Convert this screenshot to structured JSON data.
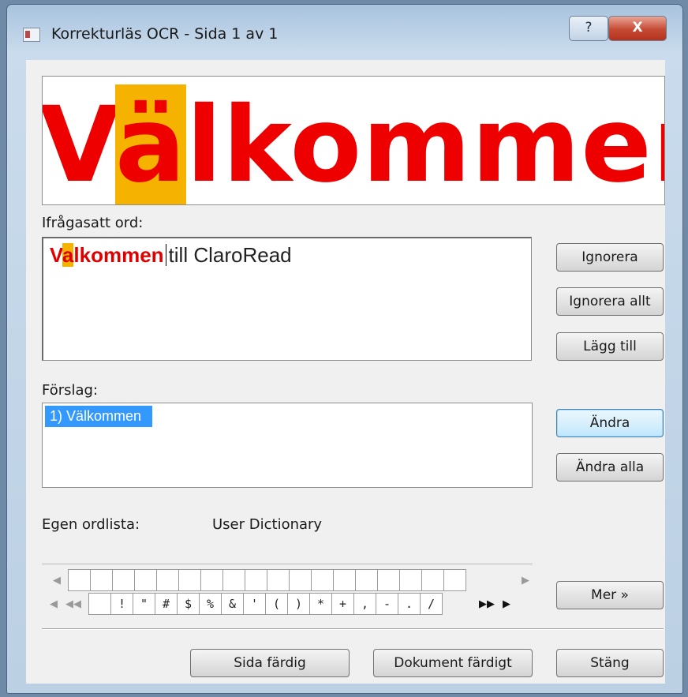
{
  "window": {
    "title": "Korrekturläs OCR - Sida 1 av 1",
    "help_label": "?",
    "close_label": "X"
  },
  "preview": {
    "word_pre": "V",
    "word_hl": "ä",
    "word_post": "lkommen"
  },
  "question": {
    "label": "Ifrågasatt ord:",
    "word_pre": "V",
    "word_hl": "a",
    "word_post": "lkommen",
    "rest": "till ClaroRead"
  },
  "suggestions": {
    "label": "Förslag:",
    "items": [
      "1) Välkommen"
    ]
  },
  "dictionary": {
    "label": "Egen ordlista:",
    "value": "User Dictionary"
  },
  "buttons": {
    "ignore": "Ignorera",
    "ignore_all": "Ignorera allt",
    "add": "Lägg till",
    "change": "Ändra",
    "change_all": "Ändra alla",
    "more": "Mer »",
    "page_done": "Sida färdig",
    "doc_done": "Dokument färdigt",
    "close": "Stäng"
  },
  "characters": {
    "row1": [
      "",
      "",
      "",
      "",
      "",
      "",
      "",
      "",
      "",
      "",
      "",
      "",
      "",
      "",
      "",
      "",
      "",
      ""
    ],
    "row2": [
      "",
      "!",
      "\"",
      "#",
      "$",
      "%",
      "&",
      "'",
      "(",
      ")",
      "*",
      "+",
      ",",
      "-",
      ".",
      "/"
    ]
  },
  "colors": {
    "highlight": "#f5b300",
    "error_text": "#ee0000",
    "selection": "#3399ff"
  }
}
